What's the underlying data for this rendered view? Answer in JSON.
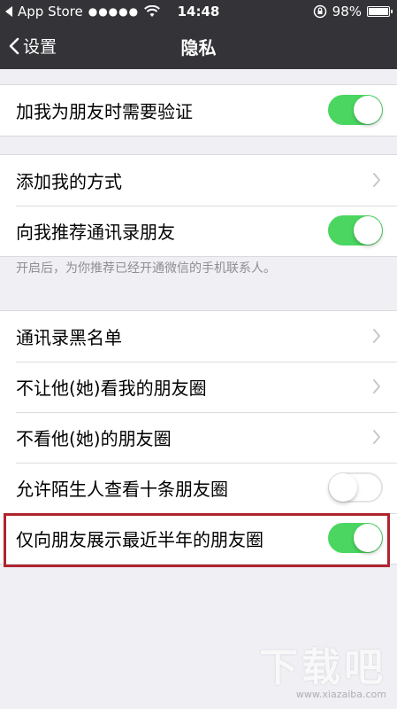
{
  "status_bar": {
    "carrier": "App Store",
    "signal": "●●●●●",
    "time": "14:48",
    "battery": "98%"
  },
  "nav": {
    "back_label": "设置",
    "title": "隐私"
  },
  "groups": [
    {
      "cells": [
        {
          "label": "加我为朋友时需要验证",
          "accessory": "toggle",
          "on": true
        }
      ]
    },
    {
      "cells": [
        {
          "label": "添加我的方式",
          "accessory": "chevron"
        },
        {
          "label": "向我推荐通讯录朋友",
          "accessory": "toggle",
          "on": true
        }
      ],
      "footnote": "开启后，为你推荐已经开通微信的手机联系人。"
    },
    {
      "cells": [
        {
          "label": "通讯录黑名单",
          "accessory": "chevron"
        },
        {
          "label": "不让他(她)看我的朋友圈",
          "accessory": "chevron"
        },
        {
          "label": "不看他(她)的朋友圈",
          "accessory": "chevron"
        },
        {
          "label": "允许陌生人查看十条朋友圈",
          "accessory": "toggle",
          "on": false
        },
        {
          "label": "仅向朋友展示最近半年的朋友圈",
          "accessory": "toggle",
          "on": true
        }
      ]
    }
  ],
  "watermark": {
    "logo": "下载吧",
    "url": "www.xiazaiba.com"
  },
  "colors": {
    "bar": "#333338",
    "toggle_on": "#4bd661",
    "highlight": "#b0242e",
    "background": "#efeff4"
  }
}
